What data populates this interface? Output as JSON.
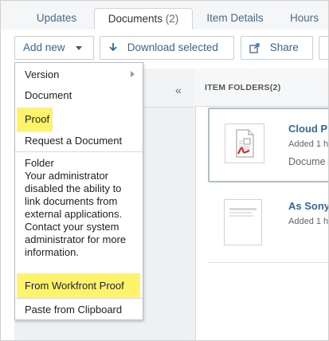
{
  "tabs": [
    {
      "label": "Updates"
    },
    {
      "label": "Documents",
      "count": "(2)"
    },
    {
      "label": "Item Details"
    },
    {
      "label": "Hours"
    }
  ],
  "toolbar": {
    "add_new": "Add new",
    "download": "Download selected",
    "share": "Share"
  },
  "menu": {
    "version": "Version",
    "document": "Document",
    "proof": "Proof",
    "request": "Request a Document",
    "folder": "Folder",
    "note": "Your administrator disabled the ability to link documents from external applications. Contact your system administrator for more information.",
    "from_workfront_proof": "From Workfront Proof",
    "paste": "Paste from Clipboard"
  },
  "pane": {
    "collapse_glyph": "«"
  },
  "folders": {
    "header": "ITEM FOLDERS(2)"
  },
  "documents": [
    {
      "name": "Cloud P",
      "added": "Added 1 h",
      "type": "Docume"
    },
    {
      "name": "As Sony",
      "added": "Added 1 h"
    }
  ],
  "colors": {
    "highlight": "#fff36b",
    "link": "#35689a",
    "pdf_red": "#d0312d"
  },
  "icons": [
    "submenu-arrow-icon",
    "download-arrow-icon",
    "share-icon",
    "caret-down-icon",
    "pdf-file-icon",
    "document-preview-icon"
  ]
}
